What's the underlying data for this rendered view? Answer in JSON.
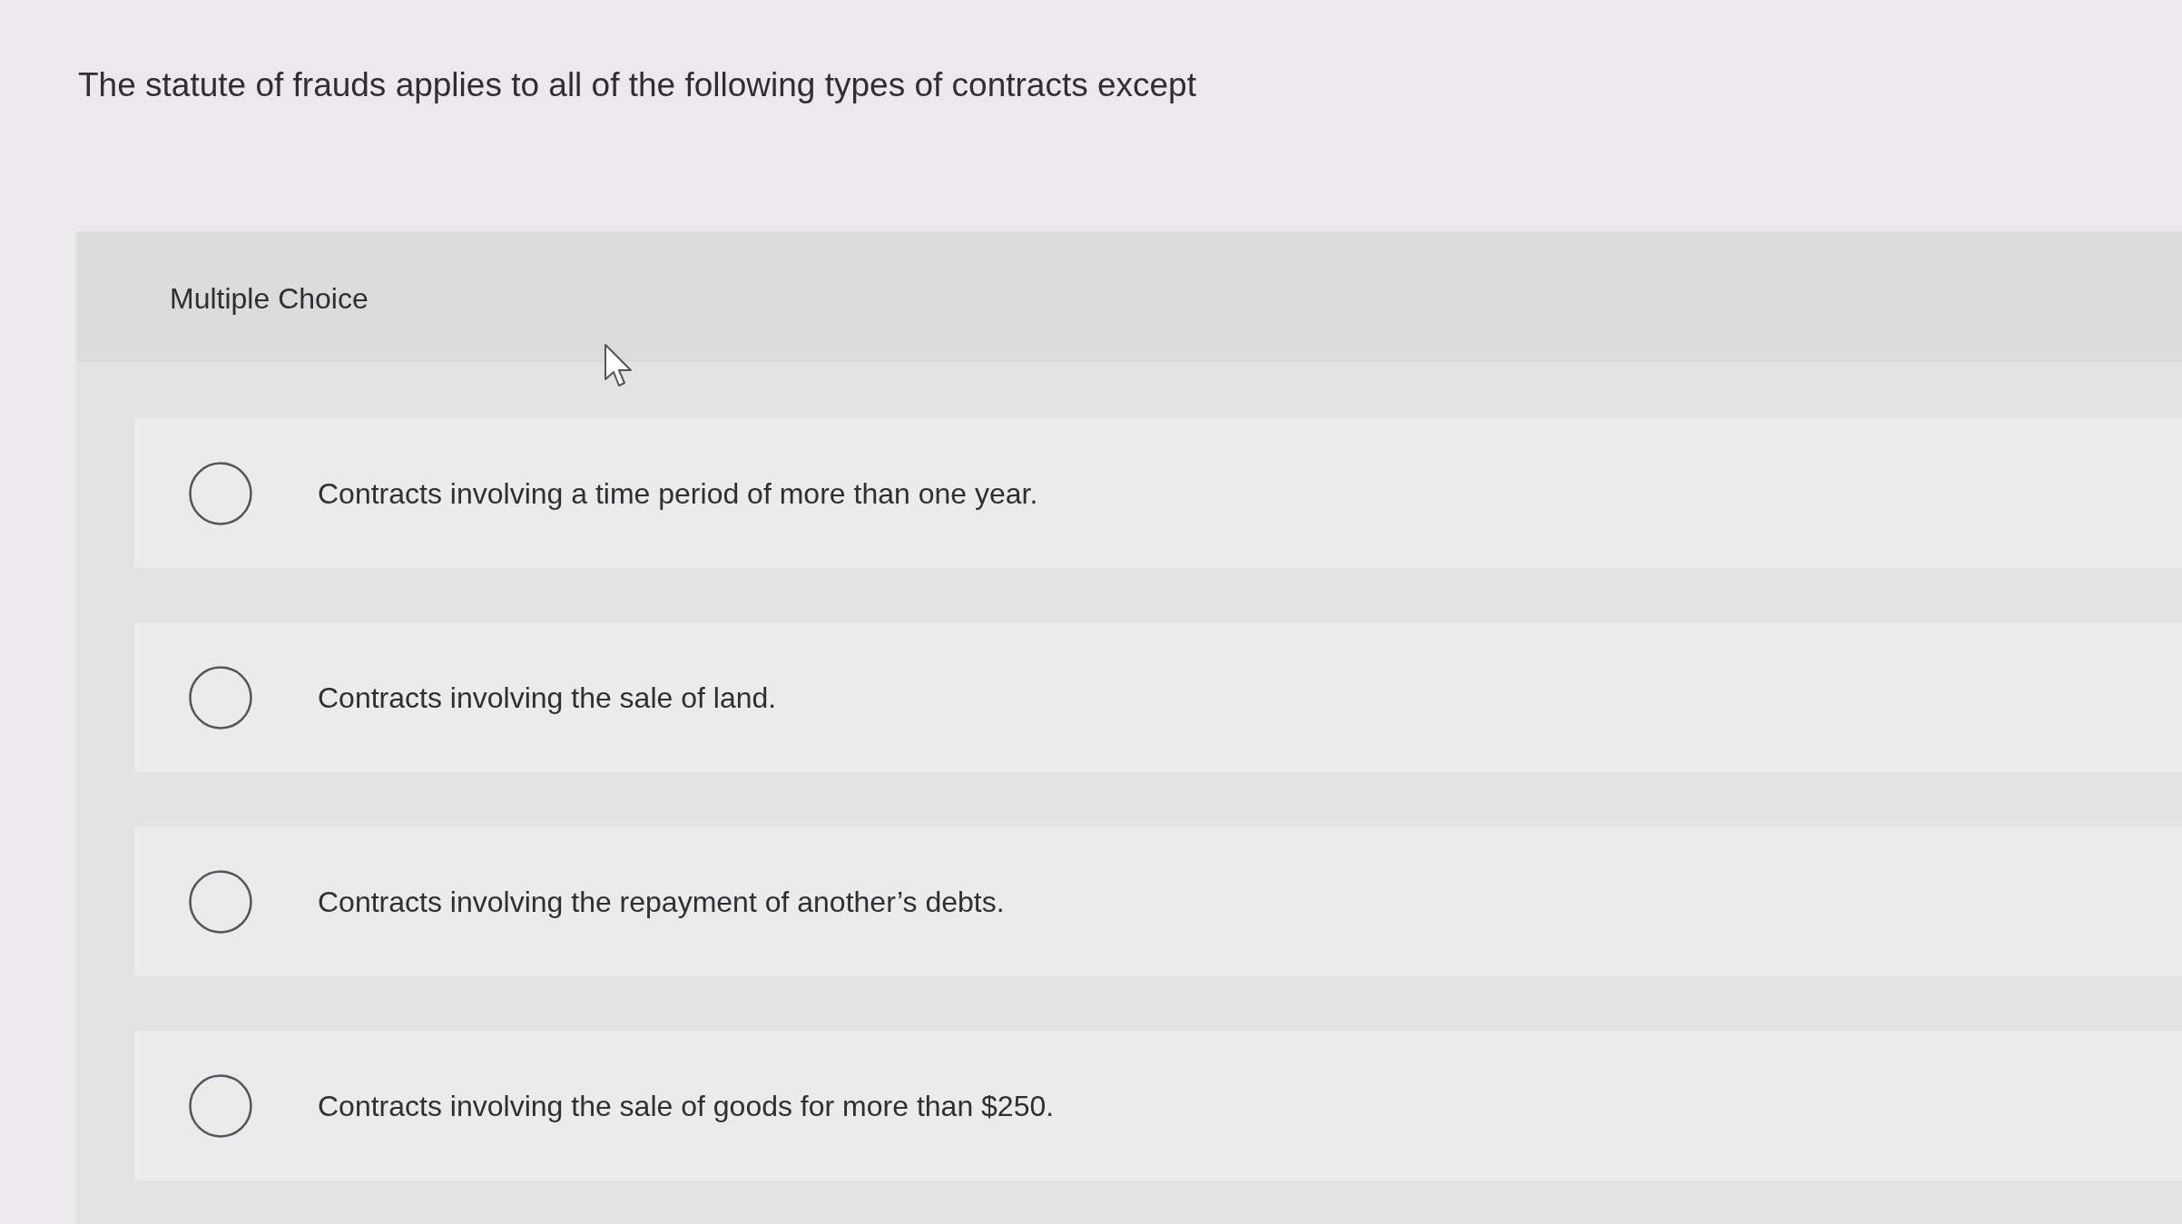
{
  "question": {
    "text": "The statute of frauds applies to all of the following types of contracts except"
  },
  "panel": {
    "heading": "Multiple Choice"
  },
  "options": [
    {
      "text": "Contracts involving a time period of more than one year.",
      "selected": false
    },
    {
      "text": "Contracts involving the sale of land.",
      "selected": false
    },
    {
      "text": "Contracts involving the repayment of another’s debts.",
      "selected": false
    },
    {
      "text": "Contracts involving the sale of goods for more than $250.",
      "selected": false
    }
  ]
}
